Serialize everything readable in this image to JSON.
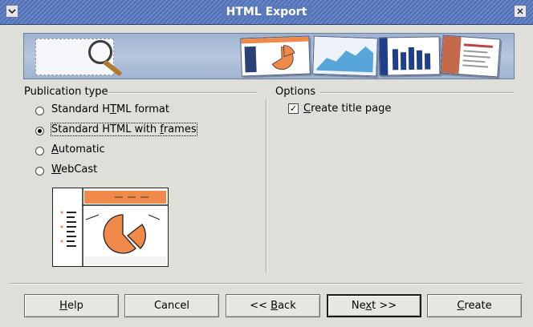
{
  "window": {
    "title": "HTML Export",
    "menu_icon": "chevron-down-icon",
    "close_icon": "close-icon"
  },
  "publication_type": {
    "heading": "Publication type",
    "options": [
      {
        "pre": "Standard H",
        "mnemonic": "T",
        "post": "ML format",
        "selected": false
      },
      {
        "pre": "Standard HTML with ",
        "mnemonic": "f",
        "post": "rames",
        "selected": true
      },
      {
        "pre": "",
        "mnemonic": "A",
        "post": "utomatic",
        "selected": false
      },
      {
        "pre": "",
        "mnemonic": "W",
        "post": "ebCast",
        "selected": false
      }
    ]
  },
  "options": {
    "heading": "Options",
    "create_title_page": {
      "pre": "",
      "mnemonic": "C",
      "post": "reate title page",
      "checked": true
    }
  },
  "buttons": {
    "help": {
      "pre": "",
      "mnemonic": "H",
      "post": "elp"
    },
    "cancel": {
      "pre": "Cancel",
      "mnemonic": "",
      "post": ""
    },
    "back": {
      "pre": "<< ",
      "mnemonic": "B",
      "post": "ack"
    },
    "next": {
      "pre": "Ne",
      "mnemonic": "x",
      "post": "t >>"
    },
    "create": {
      "pre": "",
      "mnemonic": "C",
      "post": "reate"
    }
  },
  "colors": {
    "dialog_bg": "#dedfd9",
    "titlebar": "#5a78bc",
    "accent_orange": "#f08a4b"
  }
}
